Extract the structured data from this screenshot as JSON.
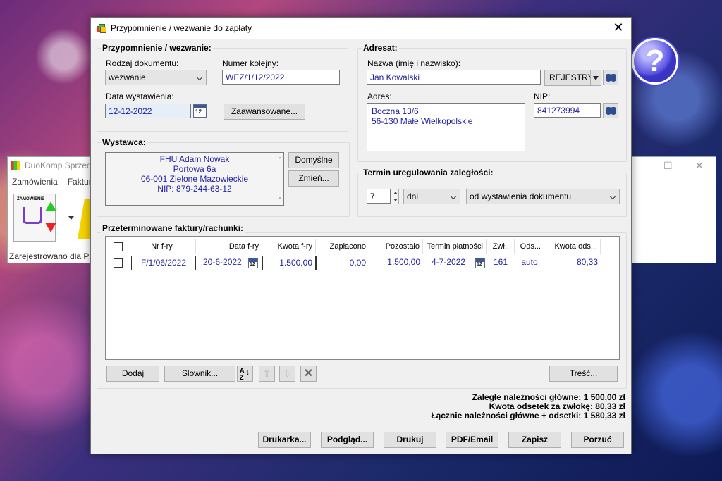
{
  "background_app": {
    "title": "DuoKomp Sprzeda",
    "menu": [
      "Zamówienia",
      "Faktur"
    ],
    "status": "Zarejestrowano dla PL",
    "tool_label": "ZAMÓWIENIE"
  },
  "dialog": {
    "title": "Przypomnienie / wezwanie do zapłaty",
    "reminder": {
      "group_label": "Przypomnienie / wezwanie:",
      "doc_type_label": "Rodzaj dokumentu:",
      "doc_type_value": "wezwanie",
      "number_label": "Numer kolejny:",
      "number_value": "WEZ/1/12/2022",
      "date_label": "Data wystawienia:",
      "date_value": "12-12-2022",
      "advanced_button": "Zaawansowane..."
    },
    "issuer": {
      "group_label": "Wystawca:",
      "lines": [
        "FHU Adam Nowak",
        "Portowa 6a",
        "06-001 Zielone Mazowieckie",
        "NIP: 879-244-63-12"
      ],
      "default_button": "Domyślne",
      "change_button": "Zmień..."
    },
    "addressee": {
      "group_label": "Adresat:",
      "name_label": "Nazwa (imię i nazwisko):",
      "name_value": "Jan Kowalski",
      "registry_button": "REJESTRY",
      "address_label": "Adres:",
      "address_lines": [
        "Boczna 13/6",
        "56-130 Małe Wielkopolskie"
      ],
      "nip_label": "NIP:",
      "nip_value": "841273994"
    },
    "term": {
      "group_label": "Termin uregulowania zaległości:",
      "value": "7",
      "unit": "dni",
      "from": "od wystawienia dokumentu"
    },
    "invoices": {
      "group_label": "Przeterminowane faktury/rachunki:",
      "columns": [
        "Nr f-ry",
        "Data f-ry",
        "Kwota f-ry",
        "Zapłacono",
        "Pozostało",
        "Termin płatności",
        "Zwł...",
        "Ods...",
        "Kwota ods..."
      ],
      "rows": [
        {
          "nr": "F/1/06/2022",
          "data": "20-6-2022",
          "kwota": "1.500,00",
          "zaplacono": "0,00",
          "pozostalo": "1.500,00",
          "termin": "4-7-2022",
          "zwloka": "161",
          "ods": "auto",
          "kwota_ods": "80,33"
        }
      ],
      "add_button": "Dodaj",
      "dict_button": "Słownik...",
      "content_button": "Treść..."
    },
    "summary": {
      "line1": "Zaległe należności główne: 1 500,00 zł",
      "line2": "Kwota odsetek za zwłokę: 80,33 zł",
      "line3": "Łącznie należności główne + odsetki: 1 580,33 zł"
    },
    "footer": {
      "printer": "Drukarka...",
      "preview": "Podgląd...",
      "print": "Drukuj",
      "pdf": "PDF/Email",
      "save": "Zapisz",
      "cancel": "Porzuć"
    },
    "calendar_icon_text": "12"
  }
}
